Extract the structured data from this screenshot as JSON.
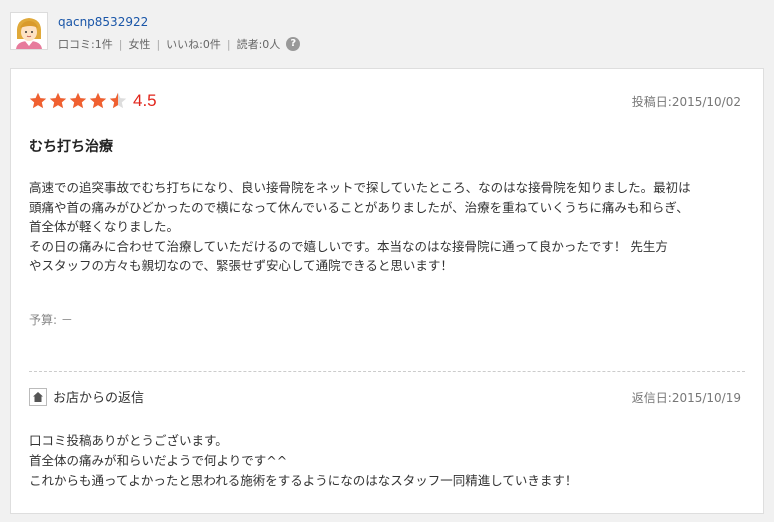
{
  "user": {
    "name": "qacnp8532922",
    "reviews": "口コミ:1件",
    "gender": "女性",
    "likes": "いいね:0件",
    "readers": "読者:0人",
    "help_symbol": "?",
    "avatar_icon": "user-avatar-icon"
  },
  "review": {
    "rating": 4.5,
    "rating_text": "4.5",
    "star_color": "#f06030",
    "score_color": "#e1251b",
    "post_date": "投稿日:2015/10/02",
    "title": "むち打ち治療",
    "body_lines": [
      "高速での追突事故でむち打ちになり、良い接骨院をネットで探していたところ、なのはな接骨院を知りました。最初は",
      "頭痛や首の痛みがひどかったので横になって休んでいることがありましたが、治療を重ねていくうちに痛みも和らぎ、",
      "首全体が軽くなりました。",
      "その日の痛みに合わせて治療していただけるので嬉しいです。本当なのはな接骨院に通って良かったです！ 先生方",
      "やスタッフの方々も親切なので、緊張せず安心して通院できると思います！"
    ],
    "budget": "予算: －"
  },
  "reply": {
    "heading": "お店からの返信",
    "date": "返信日:2015/10/19",
    "icon": "shop-home-icon",
    "body_lines": [
      "口コミ投稿ありがとうございます。",
      "首全体の痛みが和らいだようで何よりです^^",
      "これからも通ってよかったと思われる施術をするようになのはなスタッフ一同精進していきます！"
    ]
  }
}
